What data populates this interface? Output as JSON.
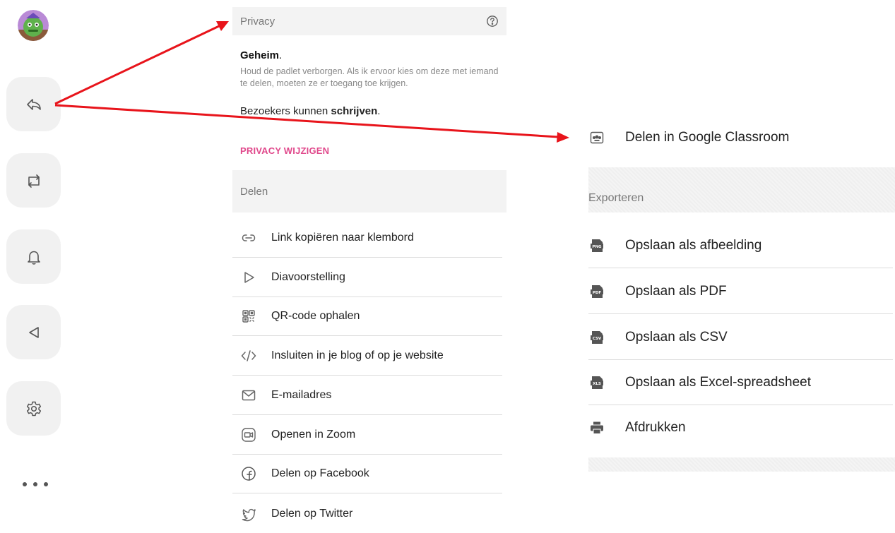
{
  "privacy": {
    "title": "Privacy",
    "mode": "Geheim",
    "mode_suffix": ".",
    "description": "Houd de padlet verborgen. Als ik ervoor kies om deze met iemand te delen, moeten ze er toegang toe krijgen.",
    "visitors_prefix": "Bezoekers kunnen ",
    "visitors_permission": "schrijven",
    "visitors_suffix": ".",
    "change_link": "PRIVACY WIJZIGEN"
  },
  "share": {
    "title": "Delen",
    "items": [
      {
        "label": "Link kopiëren naar klembord",
        "icon": "link-icon"
      },
      {
        "label": "Diavoorstelling",
        "icon": "play-icon"
      },
      {
        "label": "QR-code ophalen",
        "icon": "qr-code-icon"
      },
      {
        "label": "Insluiten in je blog of op je website",
        "icon": "code-icon"
      },
      {
        "label": "E-mailadres",
        "icon": "mail-icon"
      },
      {
        "label": "Openen in Zoom",
        "icon": "zoom-icon"
      },
      {
        "label": "Delen op Facebook",
        "icon": "facebook-icon"
      },
      {
        "label": "Delen op Twitter",
        "icon": "twitter-icon"
      }
    ]
  },
  "classroom": {
    "label": "Delen in Google Classroom",
    "icon": "google-classroom-icon"
  },
  "export": {
    "title": "Exporteren",
    "items": [
      {
        "label": "Opslaan als afbeelding",
        "icon": "png-file-icon",
        "badge": "PNG"
      },
      {
        "label": "Opslaan als PDF",
        "icon": "pdf-file-icon",
        "badge": "PDF"
      },
      {
        "label": "Opslaan als CSV",
        "icon": "csv-file-icon",
        "badge": "CSV"
      },
      {
        "label": "Opslaan als Excel-spreadsheet",
        "icon": "xls-file-icon",
        "badge": "XLS"
      },
      {
        "label": "Afdrukken",
        "icon": "printer-icon"
      }
    ]
  },
  "sidebar": {
    "buttons": [
      "share-icon",
      "remake-icon",
      "bell-icon",
      "slideshow-icon",
      "gear-icon"
    ]
  },
  "colors": {
    "accent": "#e0488b",
    "arrow": "#e8141b"
  }
}
